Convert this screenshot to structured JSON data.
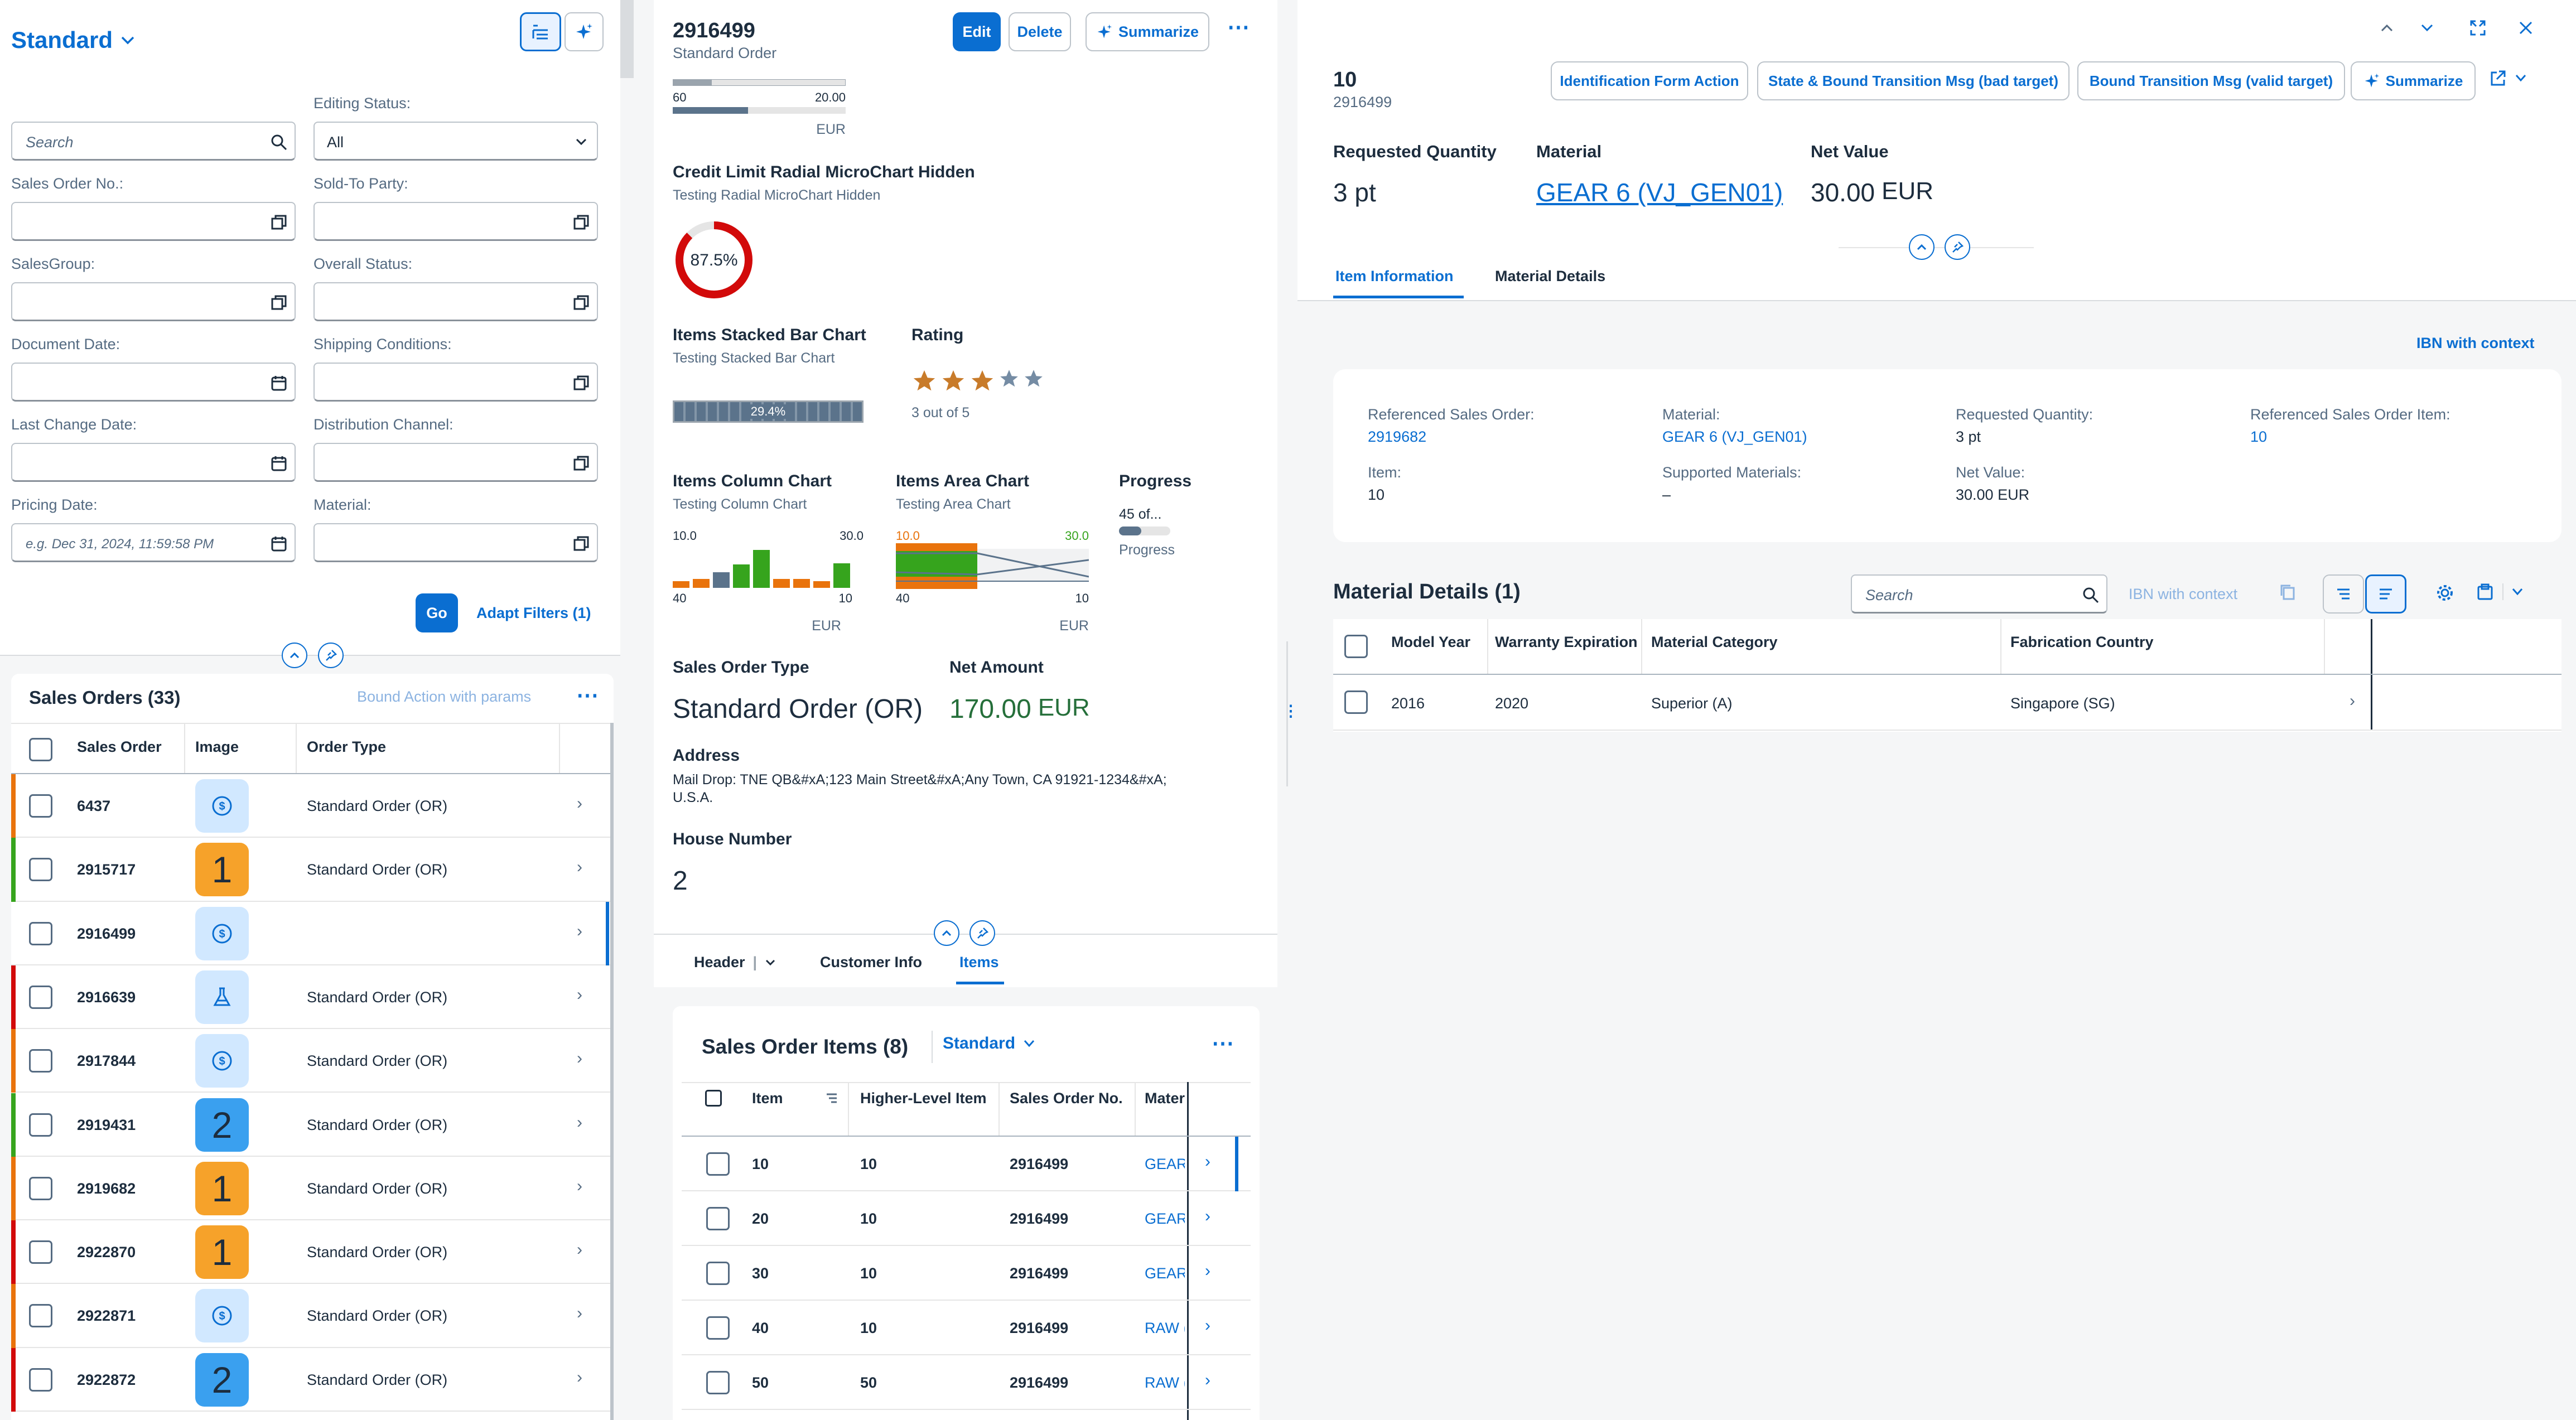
{
  "filter_panel": {
    "variant_title": "Standard",
    "search_placeholder": "Search",
    "fields": [
      {
        "label": "Editing Status:",
        "value": "All"
      },
      {
        "label": "Sales Order No.:"
      },
      {
        "label": "Sold-To Party:"
      },
      {
        "label": "SalesGroup:"
      },
      {
        "label": "Overall Status:"
      },
      {
        "label": "Document Date:"
      },
      {
        "label": "Shipping Conditions:"
      },
      {
        "label": "Last Change Date:"
      },
      {
        "label": "Distribution Channel:"
      },
      {
        "label": "Pricing Date:",
        "placeholder": "e.g. Dec 31, 2024, 11:59:58 PM"
      },
      {
        "label": "Material:"
      }
    ],
    "go_label": "Go",
    "adapt_filters_label": "Adapt Filters (1)"
  },
  "sales_orders": {
    "title": "Sales Orders (33)",
    "bound_action_label": "Bound Action with params",
    "columns": [
      "Sales Order",
      "Image",
      "Order Type"
    ],
    "rows": [
      {
        "id": "6437",
        "image": "dollar-icon",
        "type": "Standard Order (OR)",
        "stripe": "#e9730c"
      },
      {
        "id": "2915717",
        "image": "1",
        "type": "Standard Order (OR)",
        "stripe": "#36a41d"
      },
      {
        "id": "2916499",
        "image": "dollar-icon",
        "type": "",
        "stripe": ""
      },
      {
        "id": "2916639",
        "image": "flask-icon",
        "type": "Standard Order (OR)",
        "stripe": "#d20a0a"
      },
      {
        "id": "2917844",
        "image": "dollar-icon",
        "type": "Standard Order (OR)",
        "stripe": "#e9730c"
      },
      {
        "id": "2919431",
        "image": "2",
        "type": "Standard Order (OR)",
        "stripe": "#36a41d"
      },
      {
        "id": "2919682",
        "image": "1",
        "type": "Standard Order (OR)",
        "stripe": "#e9730c"
      },
      {
        "id": "2922870",
        "image": "1",
        "type": "Standard Order (OR)",
        "stripe": "#d20a0a"
      },
      {
        "id": "2922871",
        "image": "dollar-icon",
        "type": "Standard Order (OR)",
        "stripe": "#e9730c"
      },
      {
        "id": "2922872",
        "image": "2",
        "type": "Standard Order (OR)",
        "stripe": "#d20a0a"
      }
    ]
  },
  "object_page": {
    "title": "2916499",
    "subtitle": "Standard Order",
    "edit_label": "Edit",
    "delete_label": "Delete",
    "summarize_label": "Summarize",
    "bullet_min": "60",
    "bullet_max": "20.00",
    "bullet_unit": "EUR",
    "radial": {
      "title": "Credit Limit Radial MicroChart Hidden",
      "subtitle": "Testing Radial MicroChart Hidden",
      "value_label": "87.5%",
      "percent": 87.5
    },
    "stacked": {
      "title": "Items Stacked Bar Chart",
      "subtitle": "Testing Stacked Bar Chart",
      "value_label": "29.4%"
    },
    "rating": {
      "title": "Rating",
      "value": 3,
      "max": 5,
      "text": "3 out of 5"
    },
    "column_chart": {
      "title": "Items Column Chart",
      "subtitle": "Testing Column Chart",
      "top_left": "10.0",
      "top_right": "30.0",
      "bottom_left": "40",
      "bottom_right": "10",
      "unit": "EUR"
    },
    "area_chart": {
      "title": "Items Area Chart",
      "subtitle": "Testing Area Chart",
      "top_left": "10.0",
      "top_right": "30.0",
      "bottom_left": "40",
      "bottom_right": "10",
      "unit": "EUR"
    },
    "progress": {
      "title": "Progress",
      "value_label": "45 of...",
      "caption": "Progress"
    },
    "sales_order_type_label": "Sales Order Type",
    "sales_order_type_value": "Standard Order (OR)",
    "net_amount_label": "Net Amount",
    "net_amount_value": "170.00",
    "net_amount_currency": "EUR",
    "address_label": "Address",
    "address_value": "Mail Drop: TNE QB&#xA;123 Main Street&#xA;Any Town, CA 91921-1234&#xA;U.S.A.",
    "house_number_label": "House Number",
    "house_number_value": "2",
    "tabs": [
      "Header",
      "Customer Info",
      "Items"
    ],
    "items_table": {
      "title": "Sales Order Items (8)",
      "variant": "Standard",
      "columns": [
        "Item",
        "Higher-Level Item",
        "Sales Order No.",
        "Mater"
      ],
      "rows": [
        {
          "item": "10",
          "higher": "10",
          "so": "2916499",
          "mat": "GEAR"
        },
        {
          "item": "20",
          "higher": "10",
          "so": "2916499",
          "mat": "GEAR"
        },
        {
          "item": "30",
          "higher": "10",
          "so": "2916499",
          "mat": "GEAR"
        },
        {
          "item": "40",
          "higher": "10",
          "so": "2916499",
          "mat": "RAW ("
        },
        {
          "item": "50",
          "higher": "50",
          "so": "2916499",
          "mat": "RAW ("
        }
      ]
    }
  },
  "item_page": {
    "title": "10",
    "subtitle": "2916499",
    "actions": [
      "Identification Form Action",
      "State & Bound Transition Msg (bad target)",
      "Bound Transition Msg (valid target)",
      "Summarize"
    ],
    "requested_quantity_label": "Requested Quantity",
    "requested_quantity_value": "3 pt",
    "material_label": "Material",
    "material_value": "GEAR 6 (VJ_GEN01)",
    "net_value_label": "Net Value",
    "net_value_value": "30.00",
    "net_value_currency": "EUR",
    "tabs": [
      "Item Information",
      "Material Details"
    ],
    "ibn_label": "IBN with context",
    "info": {
      "ref_so_label": "Referenced Sales Order:",
      "ref_so_value": "2919682",
      "material_label": "Material:",
      "material_value": "GEAR 6 (VJ_GEN01)",
      "req_qty_label": "Requested Quantity:",
      "req_qty_value": "3 pt",
      "ref_item_label": "Referenced Sales Order Item:",
      "ref_item_value": "10",
      "item_label": "Item:",
      "item_value": "10",
      "supported_label": "Supported Materials:",
      "supported_value": "–",
      "net_label": "Net Value:",
      "net_value": "30.00 EUR"
    },
    "material_details": {
      "title": "Material Details (1)",
      "search_placeholder": "Search",
      "ibn_label": "IBN with context",
      "columns": [
        "Model Year",
        "Warranty Expiration",
        "Material Category",
        "Fabrication Country"
      ],
      "rows": [
        {
          "year": "2016",
          "warranty": "2020",
          "category": "Superior (A)",
          "country": "Singapore (SG)"
        }
      ]
    }
  }
}
